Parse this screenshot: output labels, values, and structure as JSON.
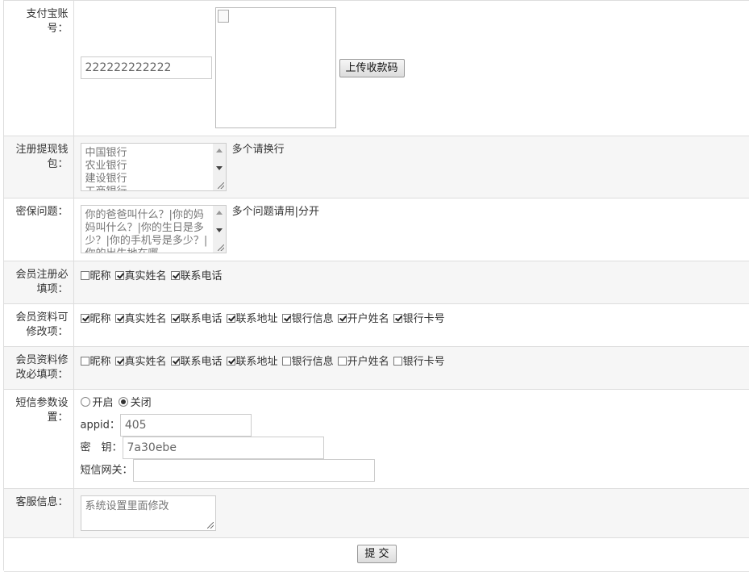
{
  "alipay": {
    "label": "支付宝账号：",
    "account_value": "222222222222",
    "upload_button": "上传收款码"
  },
  "wallet": {
    "label": "注册提现钱包：",
    "text": "中国银行\n农业银行\n建设银行\n工商银行",
    "hint": "多个请换行"
  },
  "security": {
    "label": "密保问题：",
    "text": "你的爸爸叫什么？|你的妈妈叫什么？|你的生日是多少？|你的手机号是多少？|你的出生地在哪",
    "hint": "多个问题请用|分开"
  },
  "register_required": {
    "label": "会员注册必填项：",
    "options": [
      {
        "label": "昵称",
        "checked": false
      },
      {
        "label": "真实姓名",
        "checked": true
      },
      {
        "label": "联系电话",
        "checked": true
      }
    ]
  },
  "profile_editable": {
    "label": "会员资料可修改项：",
    "options": [
      {
        "label": "昵称",
        "checked": true
      },
      {
        "label": "真实姓名",
        "checked": true
      },
      {
        "label": "联系电话",
        "checked": true
      },
      {
        "label": "联系地址",
        "checked": true
      },
      {
        "label": "银行信息",
        "checked": true
      },
      {
        "label": "开户姓名",
        "checked": true
      },
      {
        "label": "银行卡号",
        "checked": true
      }
    ]
  },
  "profile_required": {
    "label": "会员资料修改必填项：",
    "options": [
      {
        "label": "昵称",
        "checked": false
      },
      {
        "label": "真实姓名",
        "checked": true
      },
      {
        "label": "联系电话",
        "checked": true
      },
      {
        "label": "联系地址",
        "checked": true
      },
      {
        "label": "银行信息",
        "checked": false
      },
      {
        "label": "开户姓名",
        "checked": false
      },
      {
        "label": "银行卡号",
        "checked": false
      }
    ]
  },
  "sms": {
    "label": "短信参数设置：",
    "on_label": "开启",
    "off_label": "关闭",
    "selected": "off",
    "appid_label": "appid：",
    "appid_value": "405",
    "key_label": "密　钥：",
    "key_value": "7a30ebe",
    "gateway_label": "短信网关：",
    "gateway_value": ""
  },
  "service": {
    "label": "客服信息：",
    "text": "系统设置里面修改"
  },
  "submit_label": "提 交"
}
